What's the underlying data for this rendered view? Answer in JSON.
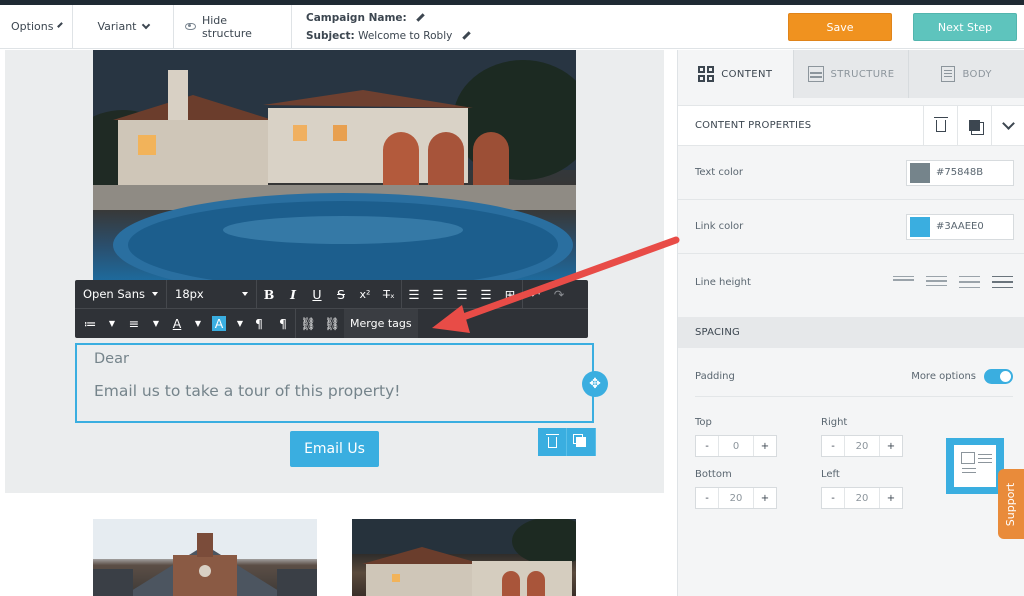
{
  "toolbar": {
    "options_label": "Options",
    "variant_label": "Variant",
    "hide_structure_label": "Hide structure",
    "campaign_name_label": "Campaign Name:",
    "subject_label": "Subject:",
    "subject_value": "Welcome to Robly",
    "save_label": "Save",
    "next_step_label": "Next Step"
  },
  "formatting_bar": {
    "font_family": "Open Sans",
    "font_size": "18px",
    "merge_tags_label": "Merge tags"
  },
  "email": {
    "text_line1": "Dear",
    "text_line2": "Email us to take a tour of this property!",
    "button_label": "Email Us"
  },
  "panel": {
    "tabs": [
      {
        "label": "CONTENT",
        "icon": "grid-icon",
        "active": true
      },
      {
        "label": "STRUCTURE",
        "icon": "structure-icon",
        "active": false
      },
      {
        "label": "BODY",
        "icon": "body-icon",
        "active": false
      }
    ],
    "content_properties_title": "CONTENT PROPERTIES",
    "text_color_label": "Text color",
    "text_color_value": "#75848B",
    "link_color_label": "Link color",
    "link_color_value": "#3AAEE0",
    "line_height_label": "Line height",
    "spacing_title": "SPACING",
    "padding_label": "Padding",
    "more_options_label": "More options",
    "more_options_enabled": true,
    "padding": {
      "top_label": "Top",
      "top_value": "0",
      "right_label": "Right",
      "right_value": "20",
      "bottom_label": "Bottom",
      "bottom_value": "20",
      "left_label": "Left",
      "left_value": "20"
    }
  },
  "support_label": "Support",
  "colors": {
    "accent": "#3aaee0",
    "save": "#f0921f",
    "next_step": "#5ec4bd",
    "text": "#75848b"
  }
}
